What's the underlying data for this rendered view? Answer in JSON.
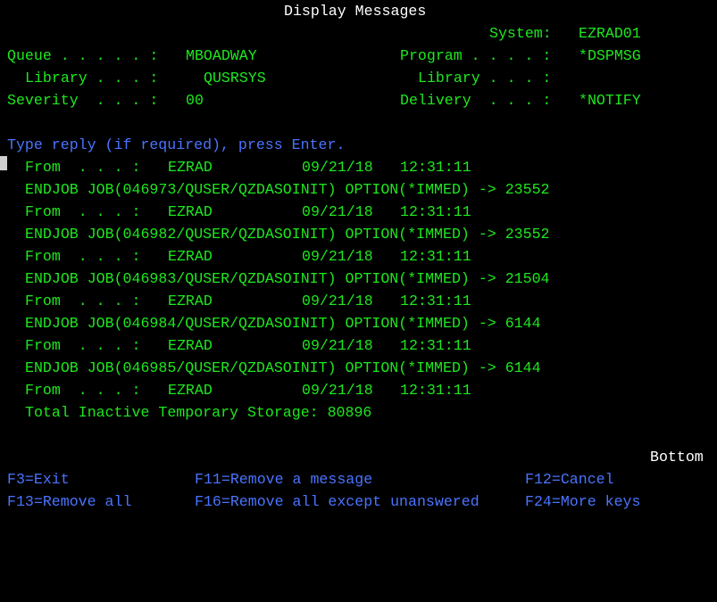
{
  "header": {
    "title": "Display Messages",
    "system_label": "System:",
    "system_value": "EZRAD01"
  },
  "fields": {
    "queue_label": "Queue . . . . . :",
    "queue_value": "MBOADWAY",
    "queue_library_label": "Library . . . :",
    "queue_library_value": "QUSRSYS",
    "severity_label": "Severity  . . . :",
    "severity_value": "00",
    "program_label": "Program . . . . :",
    "program_value": "*DSPMSG",
    "program_library_label": "Library . . . :",
    "program_library_value": "",
    "delivery_label": "Delivery  . . . :",
    "delivery_value": "*NOTIFY"
  },
  "instruction": "Type reply (if required), press Enter.",
  "messages": [
    {
      "type": "from",
      "label": "From  . . . :",
      "user": "EZRAD",
      "date": "09/21/18",
      "time": "12:31:11"
    },
    {
      "type": "text",
      "text": "ENDJOB JOB(046973/QUSER/QZDASOINIT) OPTION(*IMMED) -> 23552"
    },
    {
      "type": "from",
      "label": "From  . . . :",
      "user": "EZRAD",
      "date": "09/21/18",
      "time": "12:31:11"
    },
    {
      "type": "text",
      "text": "ENDJOB JOB(046982/QUSER/QZDASOINIT) OPTION(*IMMED) -> 23552"
    },
    {
      "type": "from",
      "label": "From  . . . :",
      "user": "EZRAD",
      "date": "09/21/18",
      "time": "12:31:11"
    },
    {
      "type": "text",
      "text": "ENDJOB JOB(046983/QUSER/QZDASOINIT) OPTION(*IMMED) -> 21504"
    },
    {
      "type": "from",
      "label": "From  . . . :",
      "user": "EZRAD",
      "date": "09/21/18",
      "time": "12:31:11"
    },
    {
      "type": "text",
      "text": "ENDJOB JOB(046984/QUSER/QZDASOINIT) OPTION(*IMMED) -> 6144"
    },
    {
      "type": "from",
      "label": "From  . . . :",
      "user": "EZRAD",
      "date": "09/21/18",
      "time": "12:31:11"
    },
    {
      "type": "text",
      "text": "ENDJOB JOB(046985/QUSER/QZDASOINIT) OPTION(*IMMED) -> 6144"
    },
    {
      "type": "from",
      "label": "From  . . . :",
      "user": "EZRAD",
      "date": "09/21/18",
      "time": "12:31:11"
    },
    {
      "type": "text",
      "text": "Total Inactive Temporary Storage: 80896"
    }
  ],
  "scroll_indicator": "Bottom",
  "function_keys": {
    "f3": "F3=Exit",
    "f11": "F11=Remove a message",
    "f12": "F12=Cancel",
    "f13": "F13=Remove all",
    "f16": "F16=Remove all except unanswered",
    "f24": "F24=More keys"
  },
  "colors": {
    "background": "#000000",
    "heading": "#ffffff",
    "field": "#1ee81e",
    "instruction": "#4a74ff"
  }
}
